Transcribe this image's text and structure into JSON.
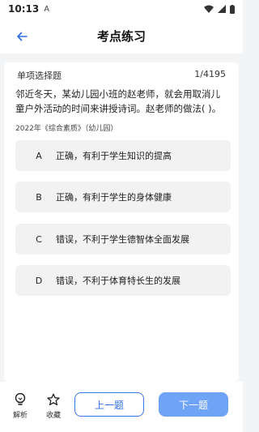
{
  "status": {
    "time": "10:13",
    "extra": "A"
  },
  "header": {
    "title": "考点练习"
  },
  "question": {
    "type": "单项选择题",
    "progress": "1/4195",
    "text": "邻近冬天，某幼儿园小班的赵老师，就会用取消儿童户外活动的时间来讲授诗词。赵老师的做法(  )。",
    "source": "2022年《综合素质》（幼儿园）"
  },
  "options": [
    {
      "letter": "A",
      "text": "正确，有利于学生知识的提高"
    },
    {
      "letter": "B",
      "text": "正确，有利于学生的身体健康"
    },
    {
      "letter": "C",
      "text": "错误，不利于学生德智体全面发展"
    },
    {
      "letter": "D",
      "text": "错误，不利于体育特长生的发展"
    }
  ],
  "toolbar": {
    "analysis_label": "解析",
    "favorite_label": "收藏",
    "prev_label": "上一题",
    "next_label": "下一题"
  },
  "colors": {
    "accent": "#2f6fe0",
    "next_button": "#6fa3f5",
    "background": "#f3f4f6"
  }
}
